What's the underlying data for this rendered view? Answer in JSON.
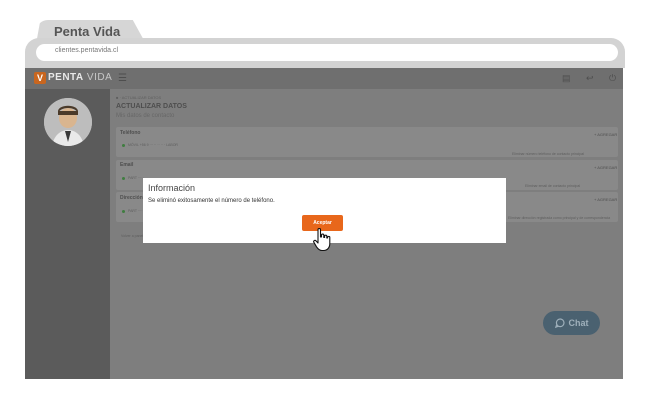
{
  "browser": {
    "tab_title": "Penta Vida",
    "url": "clientes.pentavida.cl"
  },
  "app": {
    "logo_mark": "V",
    "logo_brand": "PENTA",
    "logo_suffix": " VIDA",
    "menu_icon": "menu-icon",
    "toolbar_icons": [
      "card-icon",
      "back-icon",
      "power-icon"
    ]
  },
  "page": {
    "breadcrumb": "■ · ACTUALIZAR DATOS",
    "title": "ACTUALIZAR DATOS",
    "subtitle": "Mis datos de contacto"
  },
  "sections": [
    {
      "label": "Teléfono",
      "add_label": "+ AGREGAR",
      "row_text": "MÓVIL +56 9 ··· ·· ·· ·· · LABOR",
      "note": "Eliminar número teléfono de contacto principal"
    },
    {
      "label": "Email",
      "add_label": "+ AGREGAR",
      "row_text": "PART ·····",
      "note": "Eliminar email de contacto principal"
    },
    {
      "label": "Dirección",
      "add_label": "+ AGREGAR",
      "row_text": "PART ·····",
      "note": "Eliminar dirección registrada como principal y de correspondencia"
    }
  ],
  "footer_text": "Volver a panel",
  "chat": {
    "label": "Chat",
    "icon": "chat-bubble-icon"
  },
  "modal": {
    "title": "Información",
    "message": "Se eliminó exitosamente el número de teléfono.",
    "accept_label": "Aceptar"
  },
  "colors": {
    "accent": "#e8671b",
    "overlay_dim": "#7b7b7b",
    "chat_button": "#4a6170"
  }
}
